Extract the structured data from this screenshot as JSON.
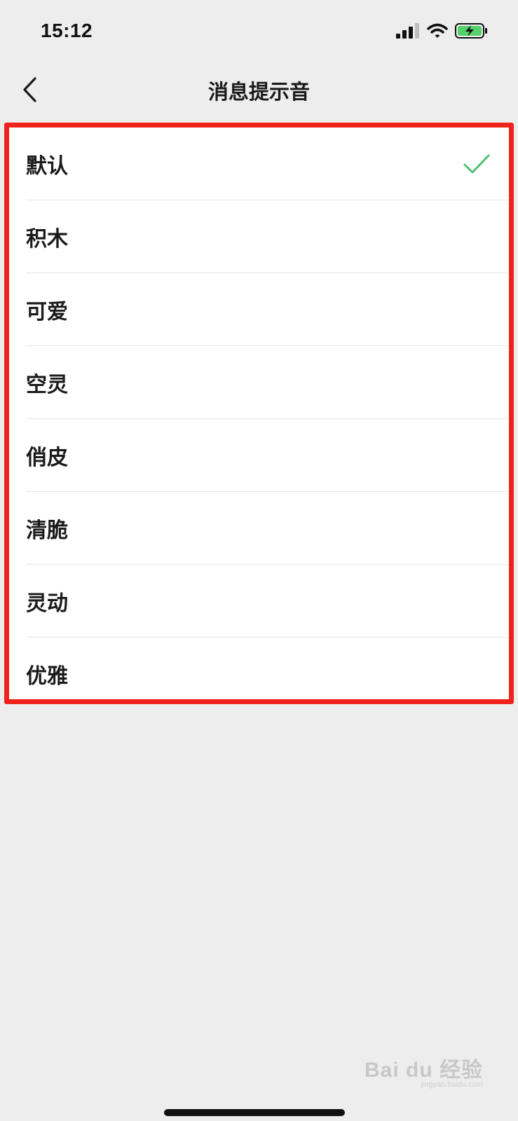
{
  "status_bar": {
    "time": "15:12",
    "icons": [
      "signal-icon",
      "wifi-icon",
      "battery-charging-icon"
    ]
  },
  "nav": {
    "title": "消息提示音",
    "back_icon": "chevron-left-icon"
  },
  "list": {
    "selected_index": 0,
    "items": [
      {
        "label": "默认"
      },
      {
        "label": "积木"
      },
      {
        "label": "可爱"
      },
      {
        "label": "空灵"
      },
      {
        "label": "俏皮"
      },
      {
        "label": "清脆"
      },
      {
        "label": "灵动"
      },
      {
        "label": "优雅"
      }
    ]
  },
  "watermark": {
    "brand": "Bai du 经验",
    "url": "jingyan.baidu.com"
  },
  "colors": {
    "background": "#ededed",
    "highlight_border": "#f0231c",
    "check": "#4fbf6e",
    "battery": "#55d06a"
  }
}
